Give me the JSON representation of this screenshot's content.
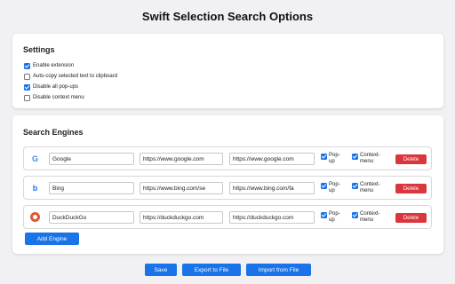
{
  "title": "Swift Selection Search Options",
  "settings": {
    "heading": "Settings",
    "options": [
      {
        "label": "Enable extension",
        "checked": true
      },
      {
        "label": "Auto-copy selected text to clipboard",
        "checked": false
      },
      {
        "label": "Disable all pop-ups",
        "checked": true
      },
      {
        "label": "Disable context menu",
        "checked": false
      }
    ]
  },
  "engines": {
    "heading": "Search Engines",
    "popup_label": "Pop-up",
    "context_label": "Context-menu",
    "delete_label": "Delete",
    "list": [
      {
        "icon": "google-icon",
        "name": "Google",
        "url1": "https://www.google.com",
        "url2": "https://www.google.com",
        "popup": true,
        "context": true
      },
      {
        "icon": "bing-icon",
        "name": "Bing",
        "url1": "https://www.bing.com/se",
        "url2": "https://www.bing.com/fa",
        "popup": true,
        "context": true
      },
      {
        "icon": "duckduckgo-icon",
        "name": "DuckDuckGo",
        "url1": "https://duckduckgo.com",
        "url2": "https://duckduckgo.com",
        "popup": true,
        "context": true
      }
    ],
    "add_label": "Add Engine"
  },
  "footer": {
    "save_label": "Save",
    "export_label": "Export to File",
    "import_label": "Import from File"
  },
  "colors": {
    "accent": "#1a73e8",
    "danger": "#d9363e"
  }
}
